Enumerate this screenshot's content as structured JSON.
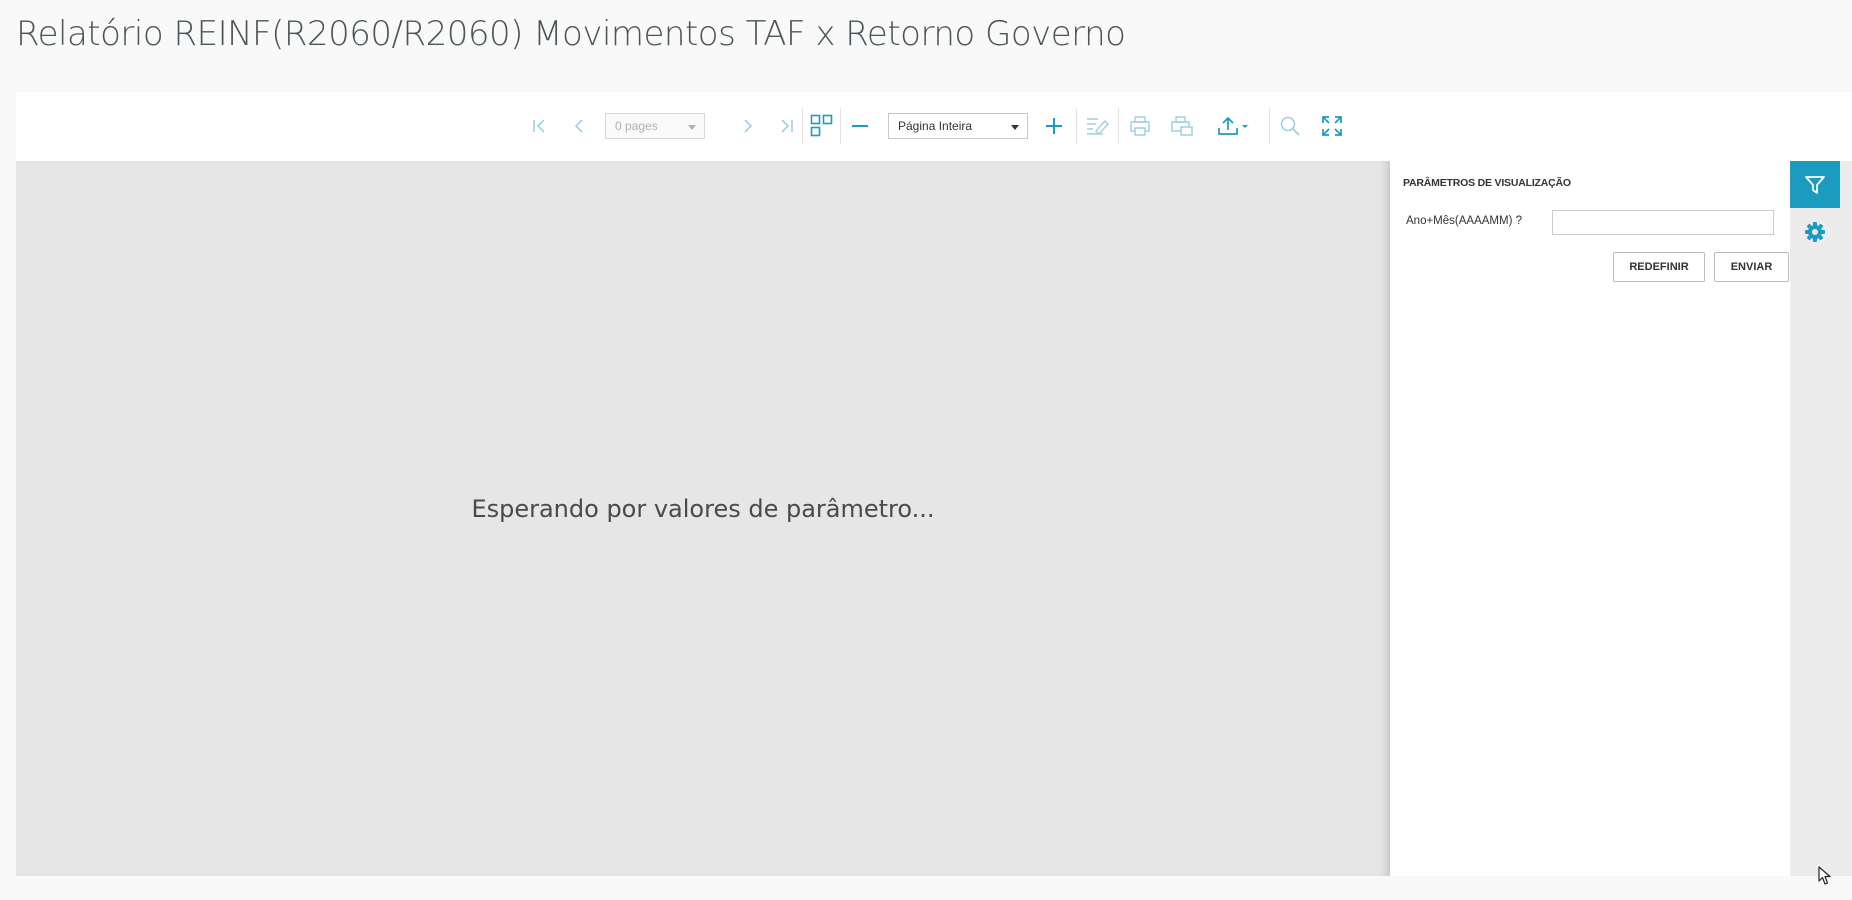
{
  "page": {
    "title": "Relatório REINF(R2060/R2060) Movimentos TAF x Retorno Governo"
  },
  "toolbar": {
    "pages_value": "0 pages",
    "zoom_value": "Página Inteira",
    "accent_color": "#1c9bc1",
    "disabled_color": "#9fd0e0"
  },
  "document": {
    "waiting_message": "Esperando por valores de parâmetro..."
  },
  "parameters": {
    "panel_title": "Parâmetros de visualização",
    "fields": [
      {
        "label": "Ano+Mês(AAAAMM) ?",
        "value": ""
      }
    ],
    "reset_label": "REDEFINIR",
    "submit_label": "ENVIAR"
  },
  "side_rail": {
    "items": [
      {
        "icon": "filter-icon",
        "active": true
      },
      {
        "icon": "gear-icon",
        "active": false
      }
    ]
  }
}
